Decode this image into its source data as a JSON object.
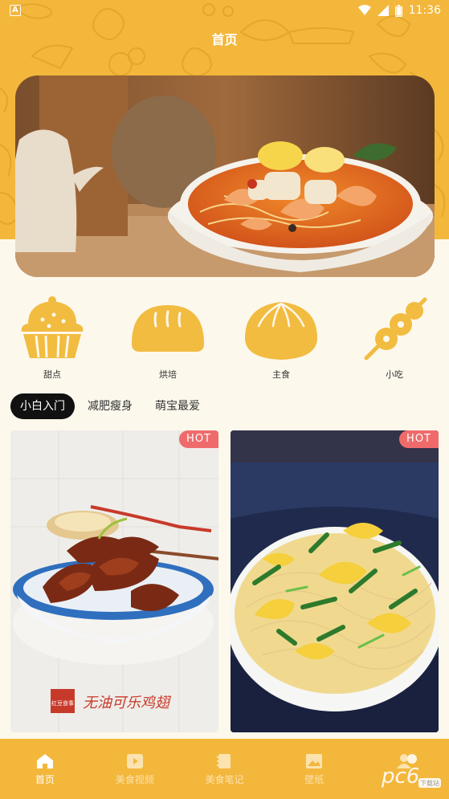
{
  "status_bar": {
    "time": "11:36",
    "app_indicator": "A"
  },
  "header": {
    "title": "首页"
  },
  "banner": {
    "image": "seafood-noodle-soup"
  },
  "categories": [
    {
      "label": "甜点",
      "icon": "cupcake-icon"
    },
    {
      "label": "烘培",
      "icon": "bread-icon"
    },
    {
      "label": "主食",
      "icon": "bun-icon"
    },
    {
      "label": "小吃",
      "icon": "skewer-icon"
    }
  ],
  "tabs": [
    {
      "label": "小白入门",
      "active": true
    },
    {
      "label": "减肥瘦身",
      "active": false
    },
    {
      "label": "萌宝最爱",
      "active": false
    }
  ],
  "cards": [
    {
      "badge": "HOT",
      "caption": "无油可乐鸡翅",
      "stamp": "红豆食事"
    },
    {
      "badge": "HOT"
    }
  ],
  "bottom_nav": [
    {
      "label": "首页",
      "icon": "home-icon",
      "active": true
    },
    {
      "label": "美食视频",
      "icon": "video-icon",
      "active": false
    },
    {
      "label": "美食笔记",
      "icon": "notebook-icon",
      "active": false
    },
    {
      "label": "壁纸",
      "icon": "image-icon",
      "active": false
    },
    {
      "label": "",
      "icon": "person-icon",
      "active": false
    }
  ],
  "watermark": {
    "text": "pc6",
    "subtext": "下载站"
  },
  "colors": {
    "accent": "#F3B73C",
    "background": "#FDF8EC",
    "hot_badge": "#EF6B6B"
  }
}
